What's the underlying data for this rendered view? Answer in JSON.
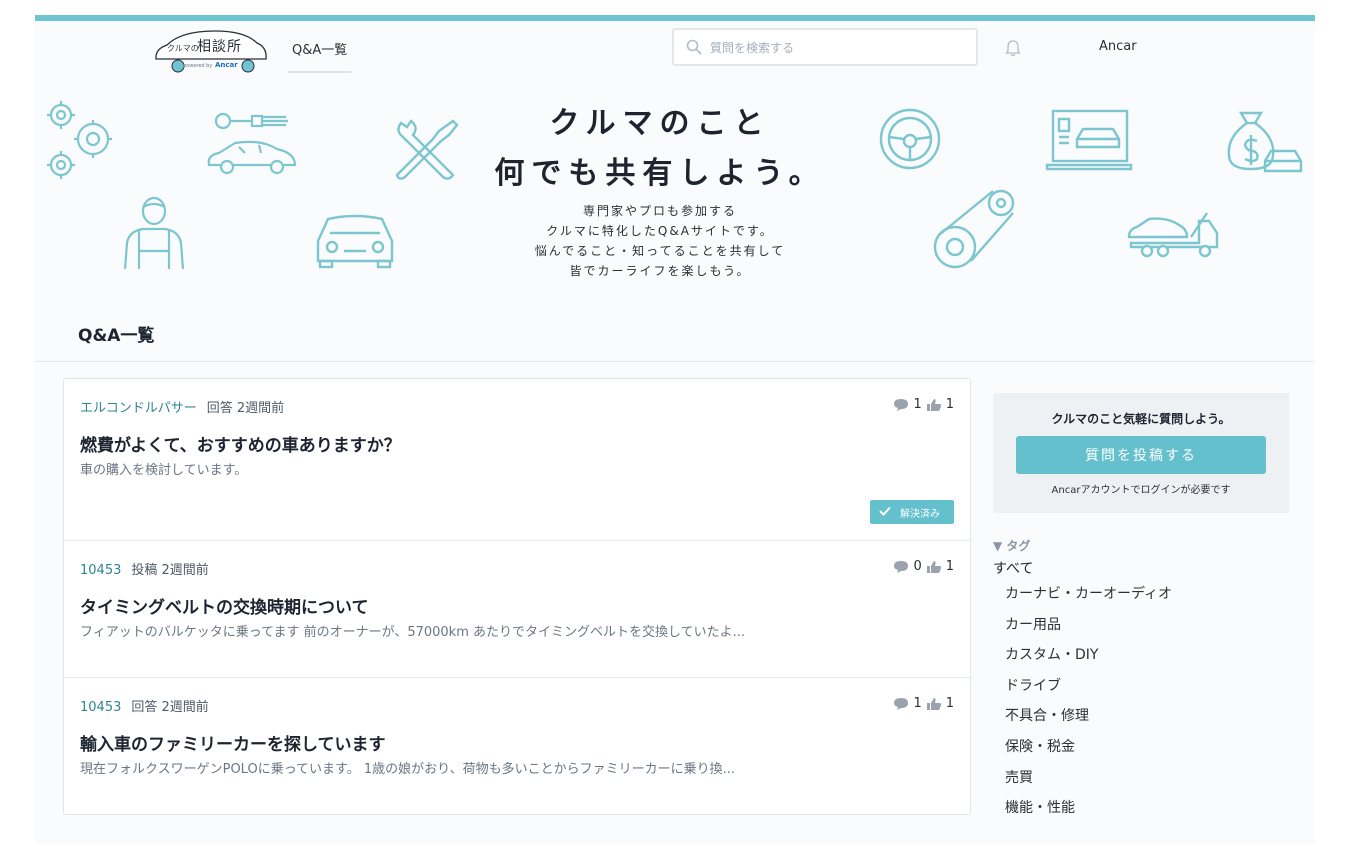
{
  "header": {
    "logo": {
      "small": "クルマの",
      "main": "相談所",
      "powered": "powered by",
      "brand": "Ancar"
    },
    "nav": {
      "qa_list": "Q&A一覧"
    },
    "search": {
      "placeholder": "質問を検索する"
    },
    "user": "Ancar"
  },
  "hero": {
    "title_lines": [
      "クルマのこと",
      "何でも共有しよう。"
    ],
    "lead_lines": [
      "専門家やプロも参加する",
      "クルマに特化したQ&Aサイトです。",
      "悩んでること・知ってることを共有して",
      "皆でカーライフを楽しもう。"
    ]
  },
  "section": {
    "title": "Q&A一覧"
  },
  "questions": [
    {
      "author": "エルコンドルパサー",
      "action": "回答",
      "time": "2週間前",
      "comments": "1",
      "likes": "1",
      "title": "燃費がよくて、おすすめの車ありますか？",
      "body": "車の購入を検討しています。",
      "badge": "解決済み"
    },
    {
      "author": "10453",
      "action": "投稿",
      "time": "2週間前",
      "comments": "0",
      "likes": "1",
      "title": "タイミングベルトの交換時期について",
      "body": "フィアットのバルケッタに乗ってます 前のオーナーが、57000km あたりでタイミングベルトを交換していたよ..."
    },
    {
      "author": "10453",
      "action": "回答",
      "time": "2週間前",
      "comments": "1",
      "likes": "1",
      "title": "輸入車のファミリーカーを探しています",
      "body": "現在フォルクスワーゲンPOLOに乗っています。 1歳の娘がおり、荷物も多いことからファミリーカーに乗り換..."
    }
  ],
  "sidebar": {
    "cta": "クルマのこと気軽に質問しよう。",
    "post_button": "質問を投稿する",
    "note": "Ancarアカウントでログインが必要です",
    "tags_heading": "▼ タグ",
    "tags_all": "すべて",
    "tags": [
      "カーナビ・カーオーディオ",
      "カー用品",
      "カスタム・DIY",
      "ドライブ",
      "不具合・修理",
      "保険・税金",
      "売買",
      "機能・性能"
    ]
  },
  "colors": {
    "accent": "#63c0cc",
    "top_bar": "#6ec4d0",
    "author_link": "#2f8593",
    "icon_line": "#7cc6d0"
  }
}
